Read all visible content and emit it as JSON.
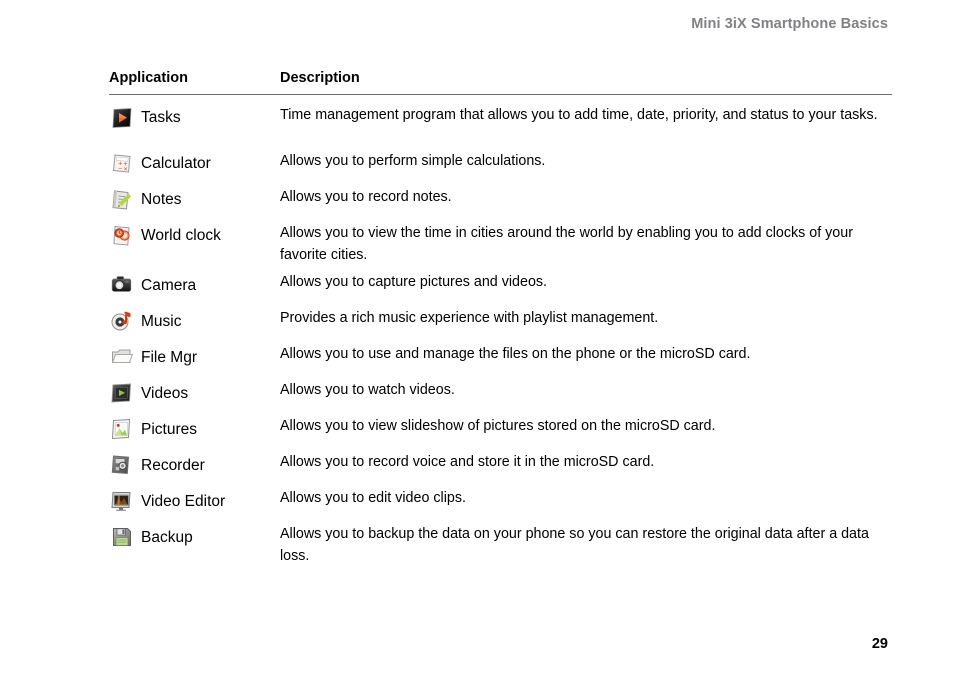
{
  "header": {
    "running_title": "Mini 3iX Smartphone Basics"
  },
  "table": {
    "columns": {
      "application": "Application",
      "description": "Description"
    },
    "rows": [
      {
        "icon": "tasks-icon",
        "app": "Tasks",
        "description": "Time management program that allows you to add time, date, priority, and status to your tasks."
      },
      {
        "icon": "calculator-icon",
        "app": "Calculator",
        "description": "Allows you to perform simple calculations."
      },
      {
        "icon": "notes-icon",
        "app": "Notes",
        "description": "Allows you to record notes."
      },
      {
        "icon": "world-clock-icon",
        "app": "World clock",
        "description": "Allows you to view the time in cities around the world by enabling you to add clocks of your favorite cities."
      },
      {
        "icon": "camera-icon",
        "app": "Camera",
        "description": "Allows you to capture pictures and videos."
      },
      {
        "icon": "music-icon",
        "app": "Music",
        "description": "Provides a rich music experience with playlist management."
      },
      {
        "icon": "file-manager-icon",
        "app": "File Mgr",
        "description": "Allows you to use and manage the files on the phone or the microSD card."
      },
      {
        "icon": "videos-icon",
        "app": "Videos",
        "description": "Allows you to watch videos."
      },
      {
        "icon": "pictures-icon",
        "app": "Pictures",
        "description": "Allows you to view slideshow of pictures stored on the microSD card."
      },
      {
        "icon": "recorder-icon",
        "app": "Recorder",
        "description": "Allows you to record voice and store it in the microSD card."
      },
      {
        "icon": "video-editor-icon",
        "app": "Video Editor",
        "description": "Allows you to edit video clips."
      },
      {
        "icon": "backup-icon",
        "app": "Backup",
        "description": "Allows you to backup the data on your phone so you can restore the original data after a data loss."
      }
    ]
  },
  "footer": {
    "page_number": "29"
  },
  "colors": {
    "header_gray": "#808184",
    "rule": "#6e6f71",
    "accent_orange": "#e8601c",
    "accent_green": "#8cc63f",
    "text": "#000000"
  }
}
